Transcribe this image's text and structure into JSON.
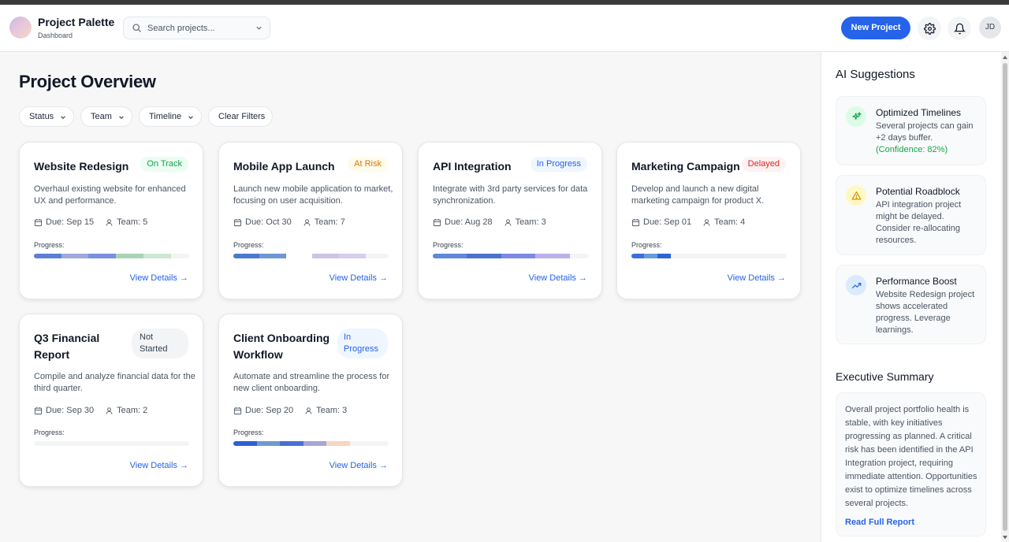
{
  "app": {
    "title": "Project Palette",
    "subtitle": "Dashboard"
  },
  "search": {
    "placeholder": "Search projects..."
  },
  "header": {
    "new_project_label": "New Project",
    "avatar_initials": "JD"
  },
  "page": {
    "title": "Project Overview"
  },
  "filters": [
    {
      "label": "Status"
    },
    {
      "label": "Team"
    },
    {
      "label": "Timeline"
    },
    {
      "label": "Clear Filters"
    }
  ],
  "progress_label": "Progress:",
  "view_details_label": "View Details →",
  "projects": [
    {
      "title": "Website Redesign",
      "status": "On Track",
      "status_color": "#16a34a",
      "description": "Overhaul existing website for enhanced UX and performance.",
      "due": "Due: Sep 15",
      "team": "Team: 5",
      "progress": 0.88
    },
    {
      "title": "Mobile App Launch",
      "status": "At Risk",
      "status_color": "#d97706",
      "description": "Launch new mobile application to market, focusing on user acquisition.",
      "due": "Due: Oct 30",
      "team": "Team: 7",
      "progress": 0.85
    },
    {
      "title": "API Integration",
      "status": "In Progress",
      "status_color": "#2563eb",
      "description": "Integrate with 3rd party services for data synchronization.",
      "due": "Due: Aug 28",
      "team": "Team: 3",
      "progress": 0.88
    },
    {
      "title": "Marketing Campaign",
      "status": "Delayed",
      "status_color": "#dc2626",
      "description": "Develop and launch a new digital marketing campaign for product X.",
      "due": "Due: Sep 01",
      "team": "Team: 4",
      "progress": 0.25
    },
    {
      "title": "Q3 Financial Report",
      "status": "Not Started",
      "status_color": "#374151",
      "description": "Compile and analyze financial data for the third quarter.",
      "due": "Due: Sep 30",
      "team": "Team: 2",
      "progress": 0.0
    },
    {
      "title": "Client Onboarding Workflow",
      "status": "In Progress",
      "status_color": "#2563eb",
      "description": "Automate and streamline the process for new client onboarding.",
      "due": "Due: Sep 20",
      "team": "Team: 3",
      "progress": 0.75
    }
  ],
  "sidebar": {
    "ai_title": "AI Suggestions",
    "suggestions": [
      {
        "title": "Optimized Timelines",
        "body": "Several projects can gain +2 days buffer.",
        "confidence": "(Confidence: 82%)",
        "icon": "sparkle-icon"
      },
      {
        "title": "Potential Roadblock",
        "body": "API integration project might be delayed. Consider re-allocating resources.",
        "icon": "warning-icon"
      },
      {
        "title": "Performance Boost",
        "body": "Website Redesign project shows accelerated progress. Leverage learnings.",
        "icon": "trending-up-icon"
      }
    ],
    "exec_title": "Executive Summary",
    "exec_body": "Overall project portfolio health is stable, with key initiatives progressing as planned. A critical risk has been identified in the API Integration project, requiring immediate attention. Opportunities exist to optimize timelines across several projects.",
    "exec_link": "Read Full Report"
  },
  "colors": {
    "accent": "#2563eb",
    "success": "#16a34a",
    "warning": "#d97706",
    "danger": "#dc2626"
  }
}
